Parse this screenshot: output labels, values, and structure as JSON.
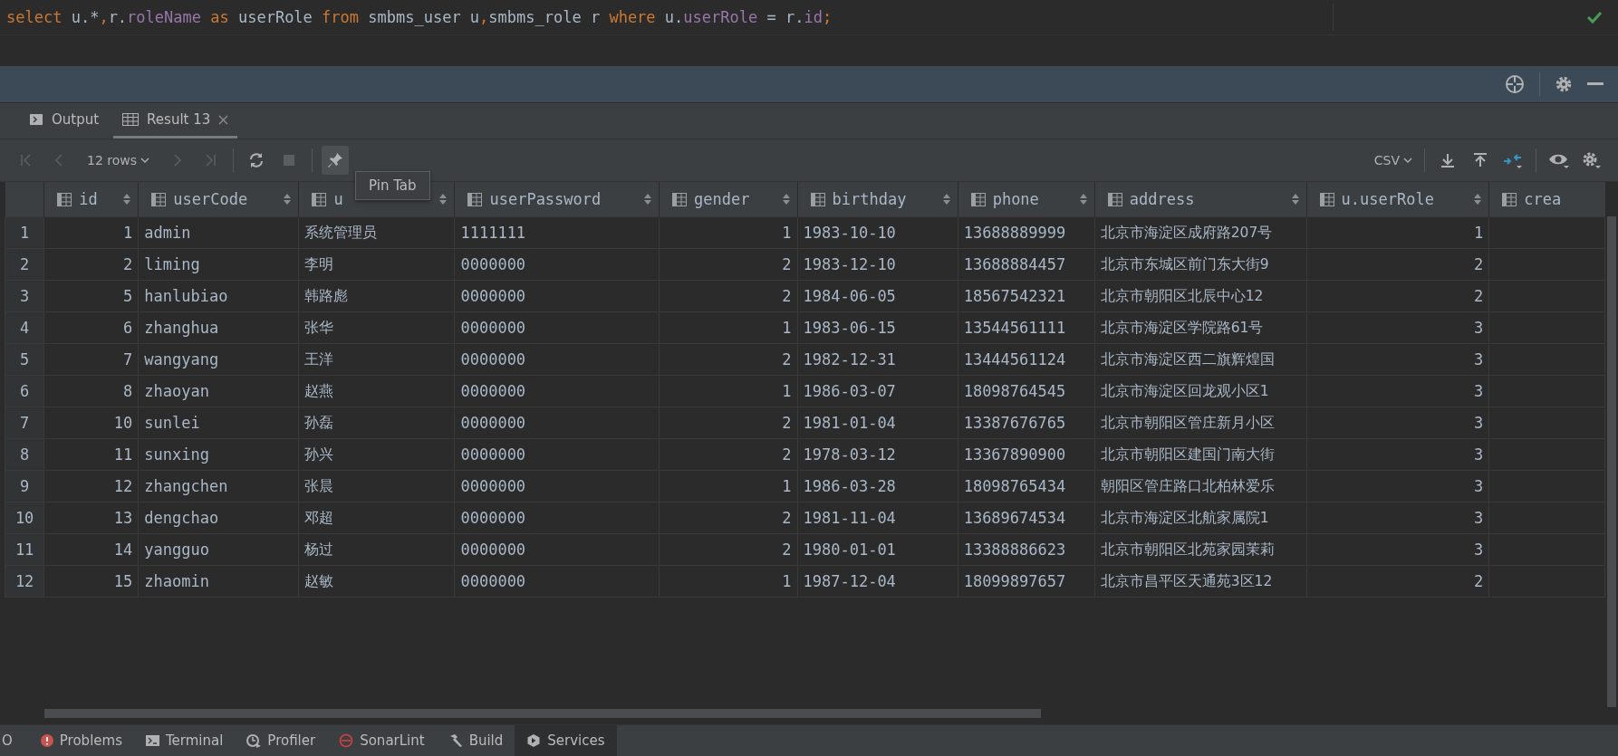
{
  "editor": {
    "tokens": [
      {
        "kind": "keyword",
        "text": "select"
      },
      {
        "kind": "plain",
        "text": " u.*"
      },
      {
        "kind": "punct",
        "text": ","
      },
      {
        "kind": "plain",
        "text": "r."
      },
      {
        "kind": "field",
        "text": "roleName"
      },
      {
        "kind": "keyword",
        "text": " as "
      },
      {
        "kind": "plain",
        "text": "userRole "
      },
      {
        "kind": "keyword",
        "text": "from"
      },
      {
        "kind": "plain",
        "text": " smbms_user u"
      },
      {
        "kind": "punct",
        "text": ","
      },
      {
        "kind": "plain",
        "text": "smbms_role r "
      },
      {
        "kind": "keyword",
        "text": "where"
      },
      {
        "kind": "plain",
        "text": " u."
      },
      {
        "kind": "field",
        "text": "userRole"
      },
      {
        "kind": "plain",
        "text": " = r."
      },
      {
        "kind": "field",
        "text": "id"
      },
      {
        "kind": "punct",
        "text": ";"
      }
    ]
  },
  "tabs": [
    {
      "label": "Output",
      "kind": "output",
      "selected": false
    },
    {
      "label": "Result 13",
      "kind": "result",
      "selected": true
    }
  ],
  "toolbar": {
    "left": [
      {
        "kind": "first",
        "disabled": true,
        "hovered": false
      },
      {
        "kind": "prev",
        "disabled": true,
        "hovered": false
      },
      {
        "kind": "rows",
        "label": "12 rows",
        "disabled": false,
        "hovered": false
      },
      {
        "kind": "next",
        "disabled": true,
        "hovered": false
      },
      {
        "kind": "last",
        "disabled": true,
        "hovered": false
      },
      {
        "kind": "refresh",
        "disabled": false,
        "hovered": false
      },
      {
        "kind": "stop",
        "disabled": true,
        "hovered": false
      },
      {
        "kind": "pin",
        "disabled": false,
        "hovered": true
      }
    ],
    "right": [
      {
        "kind": "format",
        "label": "CSV"
      },
      {
        "kind": "download"
      },
      {
        "kind": "upload"
      },
      {
        "kind": "compare"
      },
      {
        "kind": "eye"
      },
      {
        "kind": "settings"
      }
    ]
  },
  "tooltip": {
    "text": "Pin Tab"
  },
  "table": {
    "columns": [
      {
        "label": "id",
        "kind": "number"
      },
      {
        "label": "userCode",
        "kind": "text"
      },
      {
        "label": "u",
        "kind": "text"
      },
      {
        "label": "userPassword",
        "kind": "text"
      },
      {
        "label": "gender",
        "kind": "number"
      },
      {
        "label": "birthday",
        "kind": "text"
      },
      {
        "label": "phone",
        "kind": "text"
      },
      {
        "label": "address",
        "kind": "text"
      },
      {
        "label": "u.userRole",
        "kind": "number"
      },
      {
        "label": "crea",
        "kind": "text"
      }
    ],
    "rows": [
      {
        "number": "1",
        "cells": [
          "1",
          "admin",
          "系统管理员",
          "1111111",
          "1",
          "1983-10-10",
          "13688889999",
          "北京市海淀区成府路207号",
          "1"
        ]
      },
      {
        "number": "2",
        "cells": [
          "2",
          "liming",
          "李明",
          "0000000",
          "2",
          "1983-12-10",
          "13688884457",
          "北京市东城区前门东大街9",
          "2"
        ]
      },
      {
        "number": "3",
        "cells": [
          "5",
          "hanlubiao",
          "韩路彪",
          "0000000",
          "2",
          "1984-06-05",
          "18567542321",
          "北京市朝阳区北辰中心12",
          "2"
        ]
      },
      {
        "number": "4",
        "cells": [
          "6",
          "zhanghua",
          "张华",
          "0000000",
          "1",
          "1983-06-15",
          "13544561111",
          "北京市海淀区学院路61号",
          "3"
        ]
      },
      {
        "number": "5",
        "cells": [
          "7",
          "wangyang",
          "王洋",
          "0000000",
          "2",
          "1982-12-31",
          "13444561124",
          "北京市海淀区西二旗辉煌国",
          "3"
        ]
      },
      {
        "number": "6",
        "cells": [
          "8",
          "zhaoyan",
          "赵燕",
          "0000000",
          "1",
          "1986-03-07",
          "18098764545",
          "北京市海淀区回龙观小区1",
          "3"
        ]
      },
      {
        "number": "7",
        "cells": [
          "10",
          "sunlei",
          "孙磊",
          "0000000",
          "2",
          "1981-01-04",
          "13387676765",
          "北京市朝阳区管庄新月小区",
          "3"
        ]
      },
      {
        "number": "8",
        "cells": [
          "11",
          "sunxing",
          "孙兴",
          "0000000",
          "2",
          "1978-03-12",
          "13367890900",
          "北京市朝阳区建国门南大街",
          "3"
        ]
      },
      {
        "number": "9",
        "cells": [
          "12",
          "zhangchen",
          "张晨",
          "0000000",
          "1",
          "1986-03-28",
          "18098765434",
          "朝阳区管庄路口北柏林爱乐",
          "3"
        ]
      },
      {
        "number": "10",
        "cells": [
          "13",
          "dengchao",
          "邓超",
          "0000000",
          "2",
          "1981-11-04",
          "13689674534",
          "北京市海淀区北航家属院1",
          "3"
        ]
      },
      {
        "number": "11",
        "cells": [
          "14",
          "yangguo",
          "杨过",
          "0000000",
          "2",
          "1980-01-01",
          "13388886623",
          "北京市朝阳区北苑家园茉莉",
          "3"
        ]
      },
      {
        "number": "12",
        "cells": [
          "15",
          "zhaomin",
          "赵敏",
          "0000000",
          "1",
          "1987-12-04",
          "18099897657",
          "北京市昌平区天通苑3区12",
          "2"
        ]
      }
    ]
  },
  "bottom_tabs": [
    {
      "label": "O",
      "kind": "todo",
      "selected": false
    },
    {
      "label": "Problems",
      "kind": "problems",
      "selected": false
    },
    {
      "label": "Terminal",
      "kind": "terminal",
      "selected": false
    },
    {
      "label": "Profiler",
      "kind": "profiler",
      "selected": false
    },
    {
      "label": "SonarLint",
      "kind": "sonarlint",
      "selected": false
    },
    {
      "label": "Build",
      "kind": "build",
      "selected": false
    },
    {
      "label": "Services",
      "kind": "services",
      "selected": true
    }
  ]
}
